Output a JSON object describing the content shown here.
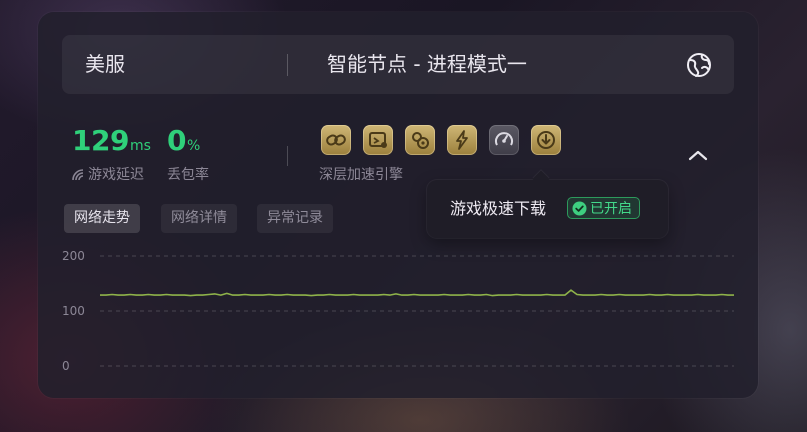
{
  "header": {
    "region": "美服",
    "node_mode": "智能节点 - 进程模式一",
    "region_icon": "globe-icon"
  },
  "stats": {
    "latency": {
      "value": "129",
      "unit": "ms",
      "label": "游戏延迟",
      "icon": "signal-icon"
    },
    "packet_loss": {
      "value": "0",
      "unit": "%",
      "label": "丢包率"
    }
  },
  "acceleration": {
    "caption": "深层加速引擎",
    "icons": [
      "link-icon",
      "dashboard-icon",
      "gears-icon",
      "lightning-icon",
      "speedometer-icon",
      "download-icon"
    ]
  },
  "tooltip": {
    "text": "游戏极速下载",
    "badge": "已开启"
  },
  "tabs": [
    {
      "label": "网络走势",
      "active": true
    },
    {
      "label": "网络详情",
      "active": false
    },
    {
      "label": "异常记录",
      "active": false
    }
  ],
  "colors": {
    "accent_green": "#2fd07a",
    "gold": "#c4a965",
    "line": "#8fb34a"
  },
  "chart_data": {
    "type": "line",
    "y_ticks": [
      "200",
      "100",
      "0"
    ],
    "ylim": [
      0,
      200
    ],
    "grid": true,
    "series": [
      {
        "values": [
          129,
          129,
          130,
          129,
          129,
          130,
          129,
          129,
          130,
          129,
          129,
          130,
          129,
          129,
          129,
          128,
          129,
          129,
          130,
          131,
          129,
          132,
          129,
          129,
          130,
          129,
          129,
          129,
          130,
          129,
          129,
          130,
          129,
          129,
          129,
          128,
          129,
          129,
          130,
          129,
          129,
          129,
          130,
          129,
          129,
          129,
          129,
          130,
          129,
          131,
          129,
          129,
          130,
          129,
          129,
          129,
          129,
          130,
          129,
          129,
          129,
          130,
          129,
          129,
          130,
          128,
          129,
          129,
          129,
          130,
          129,
          129,
          129,
          129,
          130,
          129,
          129,
          129,
          138,
          130,
          129,
          129,
          129,
          130,
          129,
          129,
          130,
          129,
          129,
          129,
          129,
          130,
          129,
          129,
          130,
          129,
          129,
          129,
          129,
          130,
          129,
          129,
          129,
          130,
          129,
          129
        ]
      }
    ]
  }
}
